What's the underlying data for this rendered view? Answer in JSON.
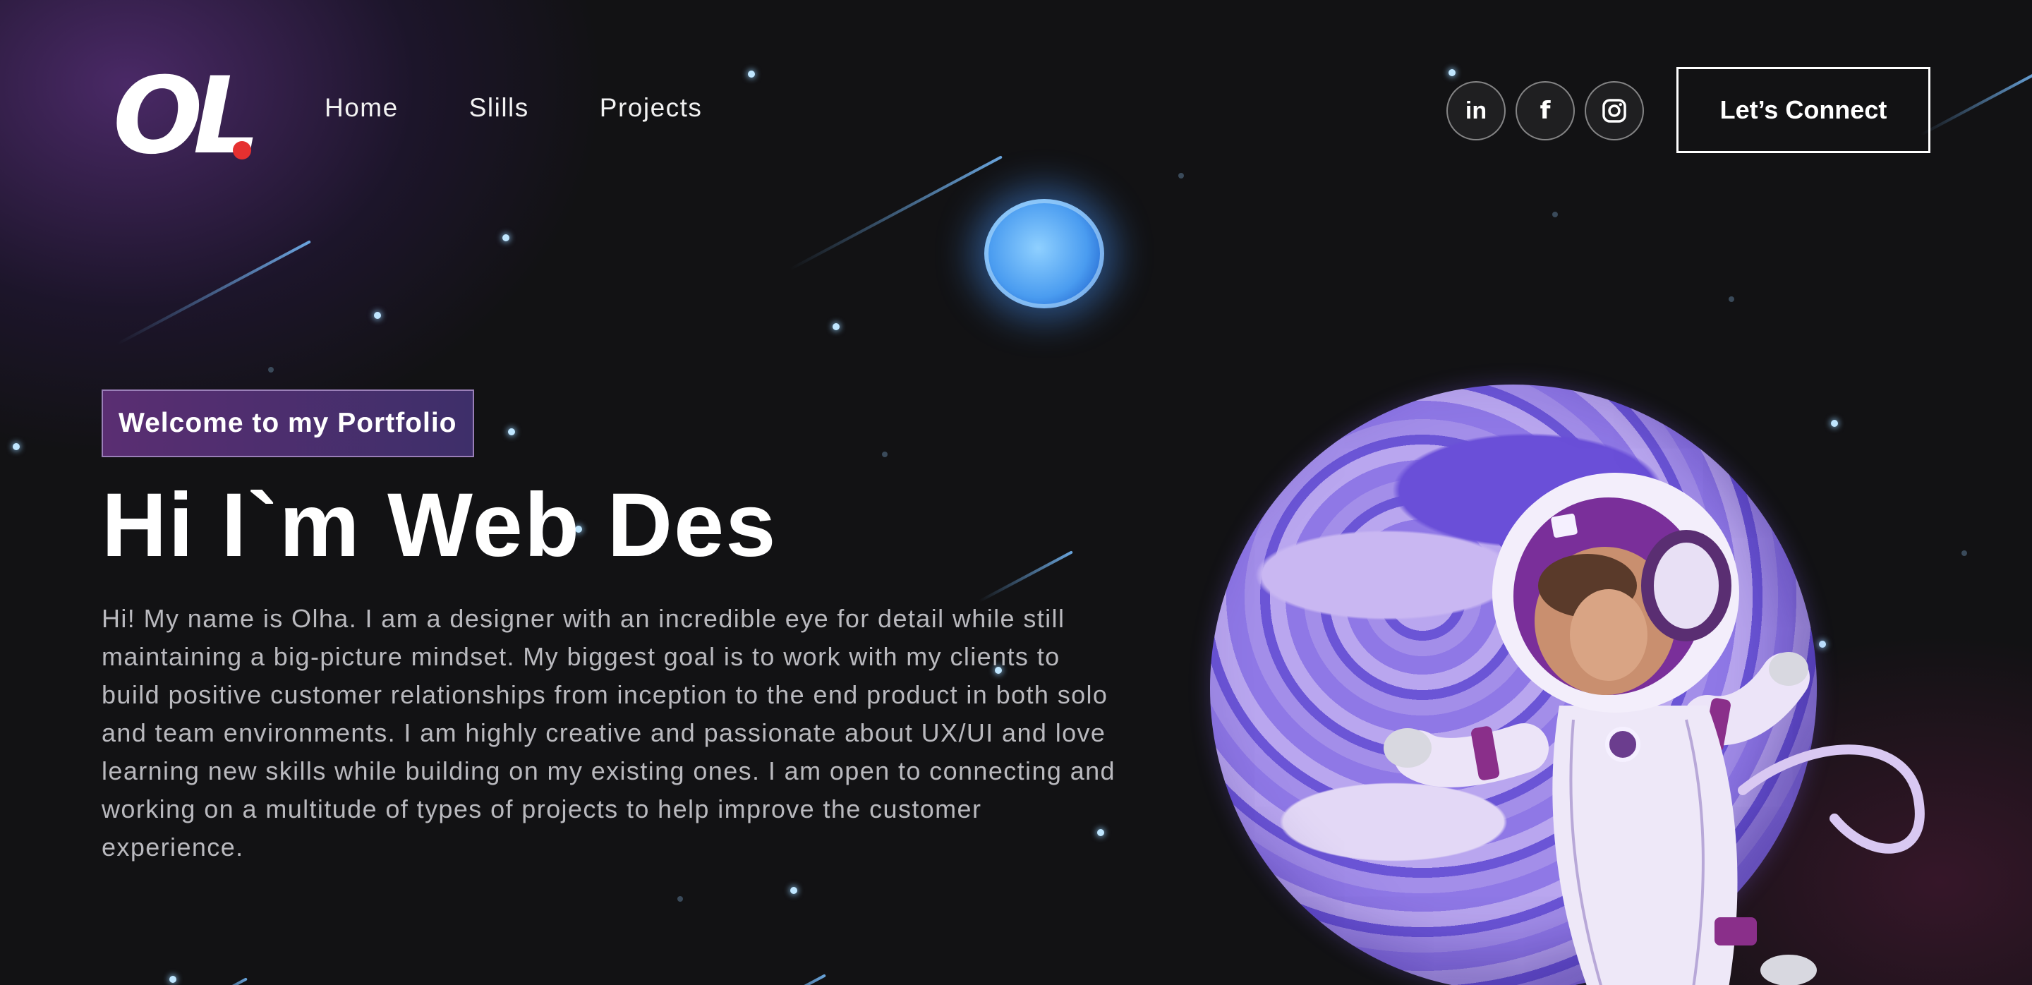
{
  "logo": {
    "text": "OL"
  },
  "nav": {
    "items": [
      "Home",
      "Slills",
      "Projects"
    ]
  },
  "socials": [
    {
      "icon": "linkedin-icon",
      "glyph": "in"
    },
    {
      "icon": "facebook-icon",
      "glyph": "f"
    },
    {
      "icon": "instagram-icon",
      "glyph": ""
    }
  ],
  "cta": {
    "label": "Let’s Connect"
  },
  "hero": {
    "badge": "Welcome to my Portfolio",
    "headline": "Hi I`m Web Des",
    "bio": "Hi! My name is Olha. I am a designer with an incredible eye for detail while still maintaining a big-picture mindset. My biggest goal is to work with my clients to build positive customer relationships from inception to the end product in both solo and team environments. I am highly creative and passionate about UX/UI and love learning new skills while building on my existing ones. I am open to connecting and working on a multitude of types of projects to help improve the customer experience."
  },
  "colors": {
    "accent_red": "#e53030",
    "badge_gradient_start": "#5a2e72",
    "badge_gradient_end": "#3e2f6a",
    "planet_purple": "#8a73e0",
    "background": "#121214"
  }
}
